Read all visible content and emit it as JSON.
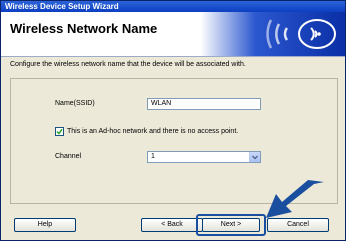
{
  "window": {
    "title": "Wireless Device Setup Wizard"
  },
  "header": {
    "title": "Wireless Network Name",
    "icon": "wireless-signal-icon"
  },
  "description": "Configure the wireless network name that the device will be associated with.",
  "form": {
    "ssid_label": "Name(SSID)",
    "ssid_value": "WLAN",
    "adhoc_label": "This is an Ad-hoc network and there is no access point.",
    "adhoc_checked": true,
    "channel_label": "Channel",
    "channel_value": "1"
  },
  "buttons": {
    "help": "Help",
    "back": "< Back",
    "next": "Next >",
    "cancel": "Cancel"
  },
  "colors": {
    "title_bar": "#0b3fc2",
    "header_gradient_end": "#0a2fa6",
    "pointer_arrow": "#1a4fa0"
  }
}
